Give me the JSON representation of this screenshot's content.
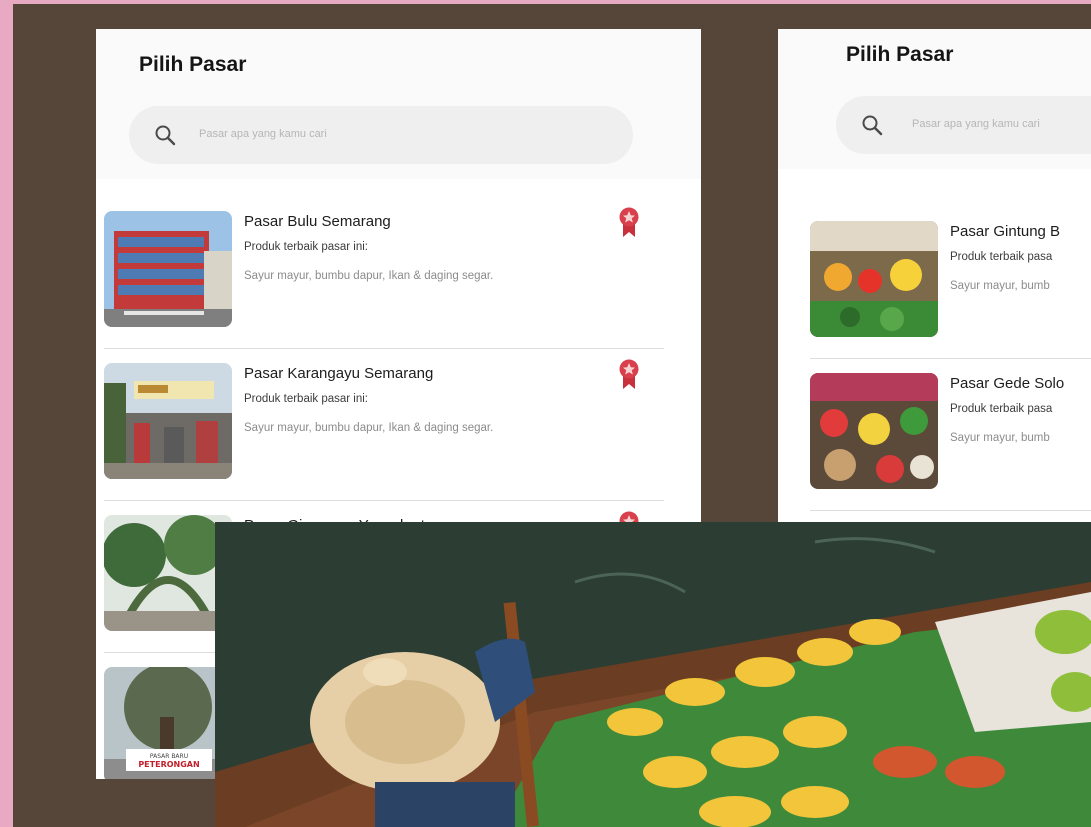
{
  "left_screen": {
    "title": "Pilih Pasar",
    "search": {
      "placeholder": "Pasar apa yang kamu cari"
    },
    "markets": [
      {
        "name": "Pasar Bulu Semarang",
        "subtitle": "Produk terbaik pasar ini:",
        "products": "Sayur mayur, bumbu dapur, Ikan & daging segar."
      },
      {
        "name": "Pasar Karangayu Semarang",
        "subtitle": "Produk terbaik pasar ini:",
        "products": "Sayur mayur, bumbu dapur, Ikan & daging segar."
      },
      {
        "name": "Pasar Giwangan Yogyakarta"
      },
      {
        "sign_text": "PASAR BARU\nPETERONGAN"
      }
    ]
  },
  "right_screen": {
    "title": "Pilih Pasar",
    "search": {
      "placeholder": "Pasar apa yang kamu cari"
    },
    "markets": [
      {
        "name": "Pasar Gintung B",
        "subtitle": "Produk terbaik pasa",
        "products": "Sayur mayur, bumb"
      },
      {
        "name": "Pasar Gede Solo",
        "subtitle": "Produk terbaik pasa",
        "products": "Sayur mayur, bumb"
      }
    ]
  },
  "colors": {
    "background_pink": "#e8aac2",
    "board_brown": "#564639",
    "badge_red": "#d8404c"
  },
  "icons": [
    "search-icon",
    "ribbon-badge-icon"
  ]
}
